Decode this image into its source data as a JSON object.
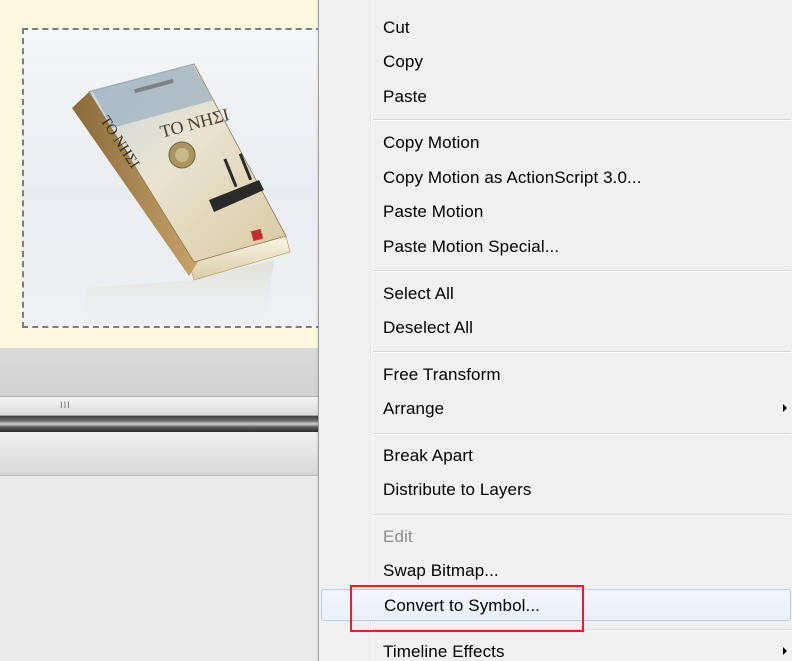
{
  "stage": {
    "image_caption_lines": [
      "TO NHΣI",
      "TO NHΣI"
    ],
    "scrollbar_grip": "III"
  },
  "context_menu": {
    "items": [
      {
        "label": "Cut"
      },
      {
        "label": "Copy"
      },
      {
        "label": "Paste"
      },
      {
        "label": "Copy Motion"
      },
      {
        "label": "Copy Motion as ActionScript 3.0..."
      },
      {
        "label": "Paste Motion"
      },
      {
        "label": "Paste Motion Special..."
      },
      {
        "label": "Select All"
      },
      {
        "label": "Deselect All"
      },
      {
        "label": "Free Transform"
      },
      {
        "label": "Arrange",
        "submenu": true
      },
      {
        "label": "Break Apart"
      },
      {
        "label": "Distribute to Layers"
      },
      {
        "label": "Edit",
        "disabled": true
      },
      {
        "label": "Swap Bitmap..."
      },
      {
        "label": "Convert to Symbol...",
        "highlighted": true
      },
      {
        "label": "Timeline Effects",
        "submenu": true
      }
    ]
  },
  "colors": {
    "stage_background": "#fbf8dd",
    "menu_background": "#f0f0f0",
    "highlight_box": "#e0232b",
    "hover_border": "#b8d0ec"
  }
}
